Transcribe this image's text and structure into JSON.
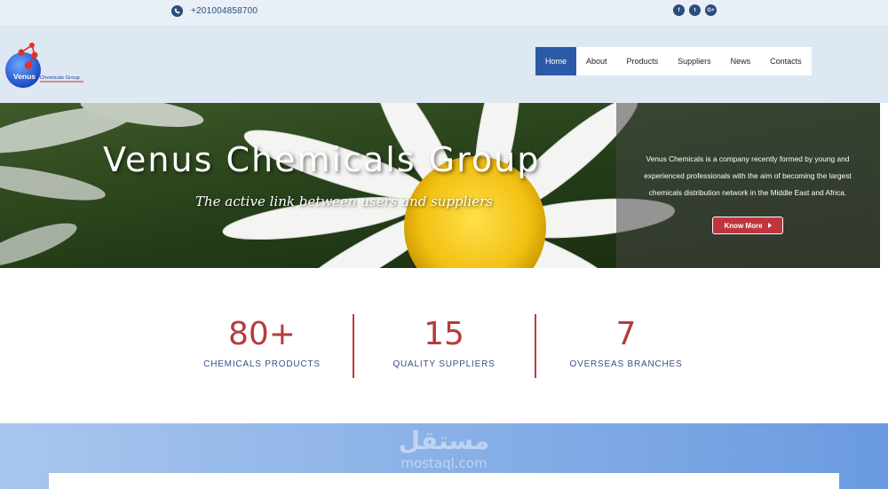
{
  "topbar": {
    "phone": "+201004858700",
    "socials": [
      {
        "icon": "facebook-icon",
        "glyph": "f"
      },
      {
        "icon": "twitter-icon",
        "glyph": "t"
      },
      {
        "icon": "google-plus-icon",
        "glyph": "G+"
      }
    ]
  },
  "logo": {
    "word": "Venus",
    "tagline": "Chemicals Group"
  },
  "nav": {
    "items": [
      {
        "label": "Home",
        "active": true
      },
      {
        "label": "About"
      },
      {
        "label": "Products"
      },
      {
        "label": "Suppliers"
      },
      {
        "label": "News"
      },
      {
        "label": "Contacts"
      }
    ]
  },
  "hero": {
    "title": "Venus Chemicals Group",
    "subtitle": "The active link between users and suppliers",
    "description": "Venus Chemicals is a company recently formed by young and experienced professionals with the aim of becoming the largest chemicals distribution network in the Middle East and Africa.",
    "button_label": "Know More"
  },
  "stats": [
    {
      "value": "80+",
      "label": "CHEMICALS PRODUCTS"
    },
    {
      "value": "15",
      "label": "QUALITY SUPPLIERS"
    },
    {
      "value": "7",
      "label": "OVERSEAS BRANCHES"
    }
  ],
  "watermark": {
    "arabic": "مستقل",
    "latin": "mostaql.com"
  },
  "colors": {
    "brand_blue": "#2a5aa8",
    "accent_red": "#c0353c",
    "stat_red": "#b73a3e",
    "label_blue": "#3a4f8a"
  }
}
